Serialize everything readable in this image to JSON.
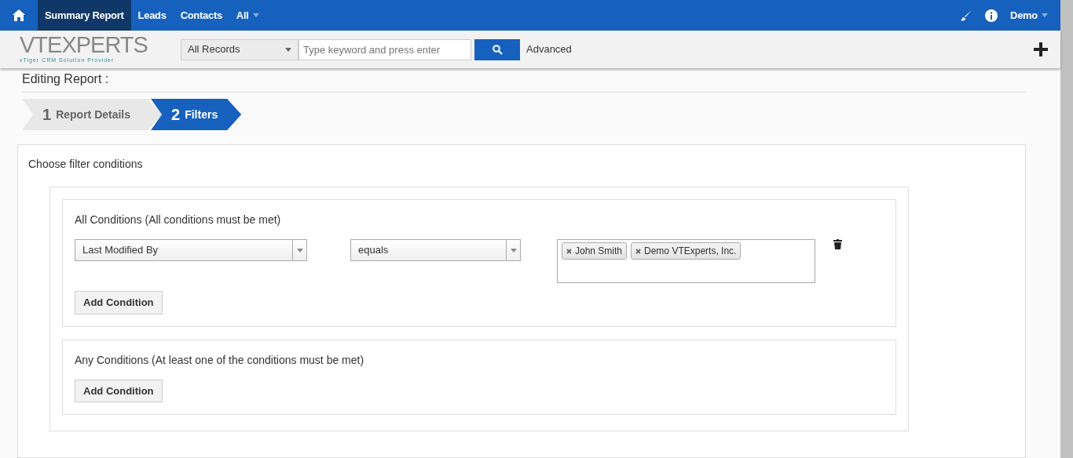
{
  "top_nav": {
    "items": [
      {
        "label": "Summary Report",
        "selected": true
      },
      {
        "label": "Leads",
        "selected": false
      },
      {
        "label": "Contacts",
        "selected": false
      },
      {
        "label": "All",
        "selected": false,
        "dropdown": true
      }
    ],
    "user": "Demo"
  },
  "logo": {
    "name": "VTEXPERTS",
    "tagline": "vTiger CRM Solution Provider"
  },
  "search": {
    "scope": "All Records",
    "placeholder": "Type keyword and press enter",
    "advanced": "Advanced"
  },
  "page_title": "Editing Report :",
  "steps": [
    {
      "number": "1",
      "label": "Report Details",
      "selected": false
    },
    {
      "number": "2",
      "label": "Filters",
      "selected": true
    }
  ],
  "filter_heading": "Choose filter conditions",
  "groups": [
    {
      "title": "All Conditions",
      "note": "(All conditions must be met)",
      "conditions": [
        {
          "field": "Last Modified By",
          "operator": "equals",
          "values": [
            "John Smith",
            "Demo VTExperts, Inc."
          ]
        }
      ],
      "button": "Add Condition"
    },
    {
      "title": "Any Conditions",
      "note": "(At least one of the conditions must be met)",
      "button": "Add Condition"
    }
  ]
}
